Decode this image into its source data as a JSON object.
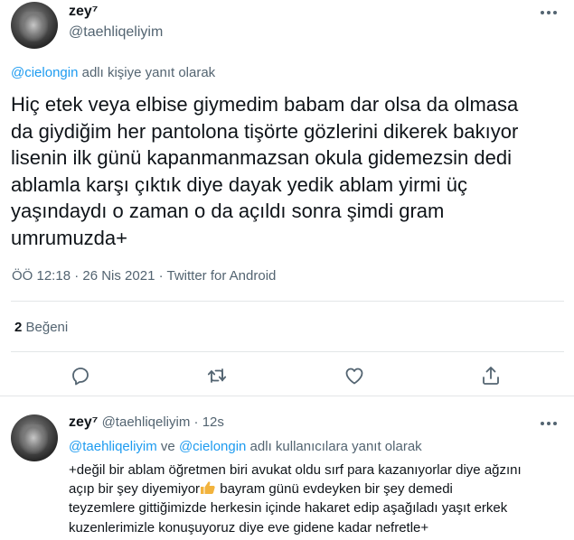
{
  "main_tweet": {
    "author_name": "zey⁷",
    "handle": "@taehliqeliyim",
    "reply_to_mention": "@cielongin",
    "reply_to_suffix": " adlı kişiye yanıt olarak",
    "text_lines": [
      "Hiç etek veya elbise giymedim babam dar olsa da olmasa",
      "da giydiğim her pantolona tişörte gözlerini dikerek bakıyor",
      "lisenin ilk günü kapanmanmazsan okula gidemezsin dedi",
      "ablamla karşı çıktık diye dayak yedik ablam yirmi üç",
      "yaşındaydı o zaman o da açıldı sonra şimdi gram",
      "umrumuzda+"
    ],
    "meta": "ÖÖ 12:18 · 26 Nis 2021 · Twitter for Android",
    "likes_count": "2",
    "likes_label": " Beğeni"
  },
  "reply_tweet": {
    "author_name": "zey⁷",
    "handle": "@taehliqeliyim",
    "separator": "·",
    "time": "12s",
    "mention_1": "@taehliqeliyim",
    "mention_join": " ve ",
    "mention_2": "@cielongin",
    "mention_suffix": " adlı kullanıcılara yanıt olarak",
    "line_1": "+değil bir ablam öğretmen biri avukat oldu sırf para kazanıyorlar diye ağzını",
    "line_2_before_emoji": "açıp bir şey diyemiyor",
    "line_2_after_emoji": " bayram günü evdeyken bir şey demedi",
    "line_3": "teyzemlere gittiğimizde herkesin içinde hakaret edip aşağıladı yaşıt erkek",
    "line_4": "kuzenlerimizle konuşuyoruz diye eve gidene kadar nefretle+"
  },
  "icons": {
    "more": "more-horizontal-icon",
    "reply": "reply-icon",
    "retweet": "retweet-icon",
    "like": "heart-icon",
    "share": "share-icon",
    "emoji": "thumbs-up-emoji"
  },
  "colors": {
    "text": "#0f1419",
    "secondary": "#536471",
    "link": "#1d9bf0",
    "divider": "#e3e6e8",
    "emoji": "#f2b33d"
  }
}
